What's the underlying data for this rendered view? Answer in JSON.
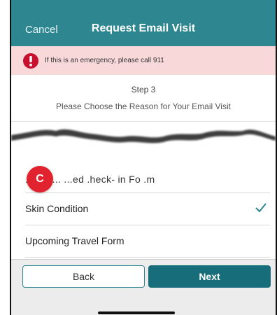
{
  "header": {
    "cancel_label": "Cancel",
    "title": "Request Email Visit"
  },
  "banner": {
    "text": "If this is an emergency, please call 911",
    "icon": "alert-icon"
  },
  "step": {
    "label": "Step 3",
    "subtitle": "Please Choose the Reason for Your Email Visit"
  },
  "badge": {
    "letter": "C"
  },
  "options": [
    {
      "label": ".ician ... ...ed .heck- in Fo .m",
      "selected": false
    },
    {
      "label": "Skin Condition",
      "selected": true
    },
    {
      "label": "Upcoming Travel Form",
      "selected": false
    }
  ],
  "partial_text": "...",
  "buttons": {
    "back_label": "Back",
    "next_label": "Next"
  },
  "colors": {
    "header_bg": "#2e8691",
    "banner_bg": "#f9d8da",
    "alert_red": "#c8102e",
    "badge_red": "#e0232e",
    "next_bg": "#176d7a",
    "check_color": "#2e8691"
  }
}
